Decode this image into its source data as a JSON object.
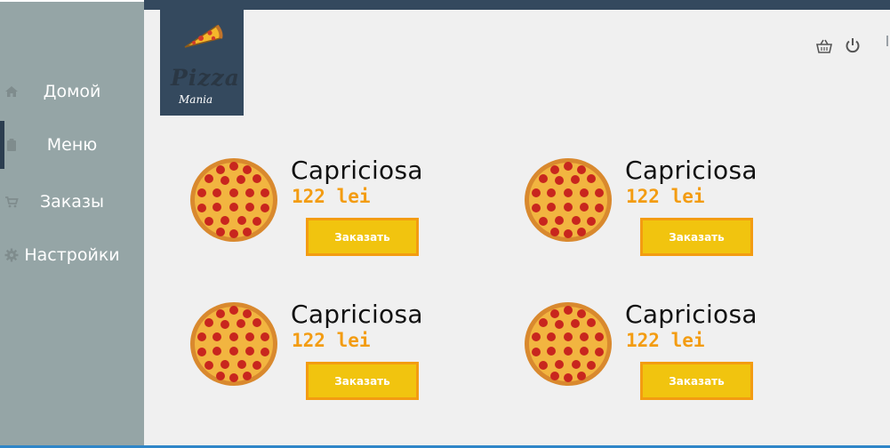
{
  "logo": {
    "text_main": "Pizza",
    "text_sub": "Mania"
  },
  "sidebar": {
    "items": [
      {
        "label": "Домой",
        "icon": "home-icon",
        "active": false
      },
      {
        "label": "Меню",
        "icon": "clipboard-icon",
        "active": true
      },
      {
        "label": "Заказы",
        "icon": "cart-icon",
        "active": false
      },
      {
        "label": "Настройки",
        "icon": "gear-icon",
        "active": false
      }
    ]
  },
  "header": {
    "icons": [
      "basket-icon",
      "power-icon"
    ]
  },
  "products": [
    {
      "name": "Capriciosa",
      "price": "122 lei",
      "button": "Заказать"
    },
    {
      "name": "Capriciosa",
      "price": "122 lei",
      "button": "Заказать"
    },
    {
      "name": "Capriciosa",
      "price": "122 lei",
      "button": "Заказать"
    },
    {
      "name": "Capriciosa",
      "price": "122 lei",
      "button": "Заказать"
    }
  ],
  "colors": {
    "sidebar": "#95a5a6",
    "logo_bg": "#34495e",
    "button_fill": "#f1c40f",
    "button_border": "#f39c12",
    "price": "#f39c12",
    "background": "#f0f0f0"
  }
}
